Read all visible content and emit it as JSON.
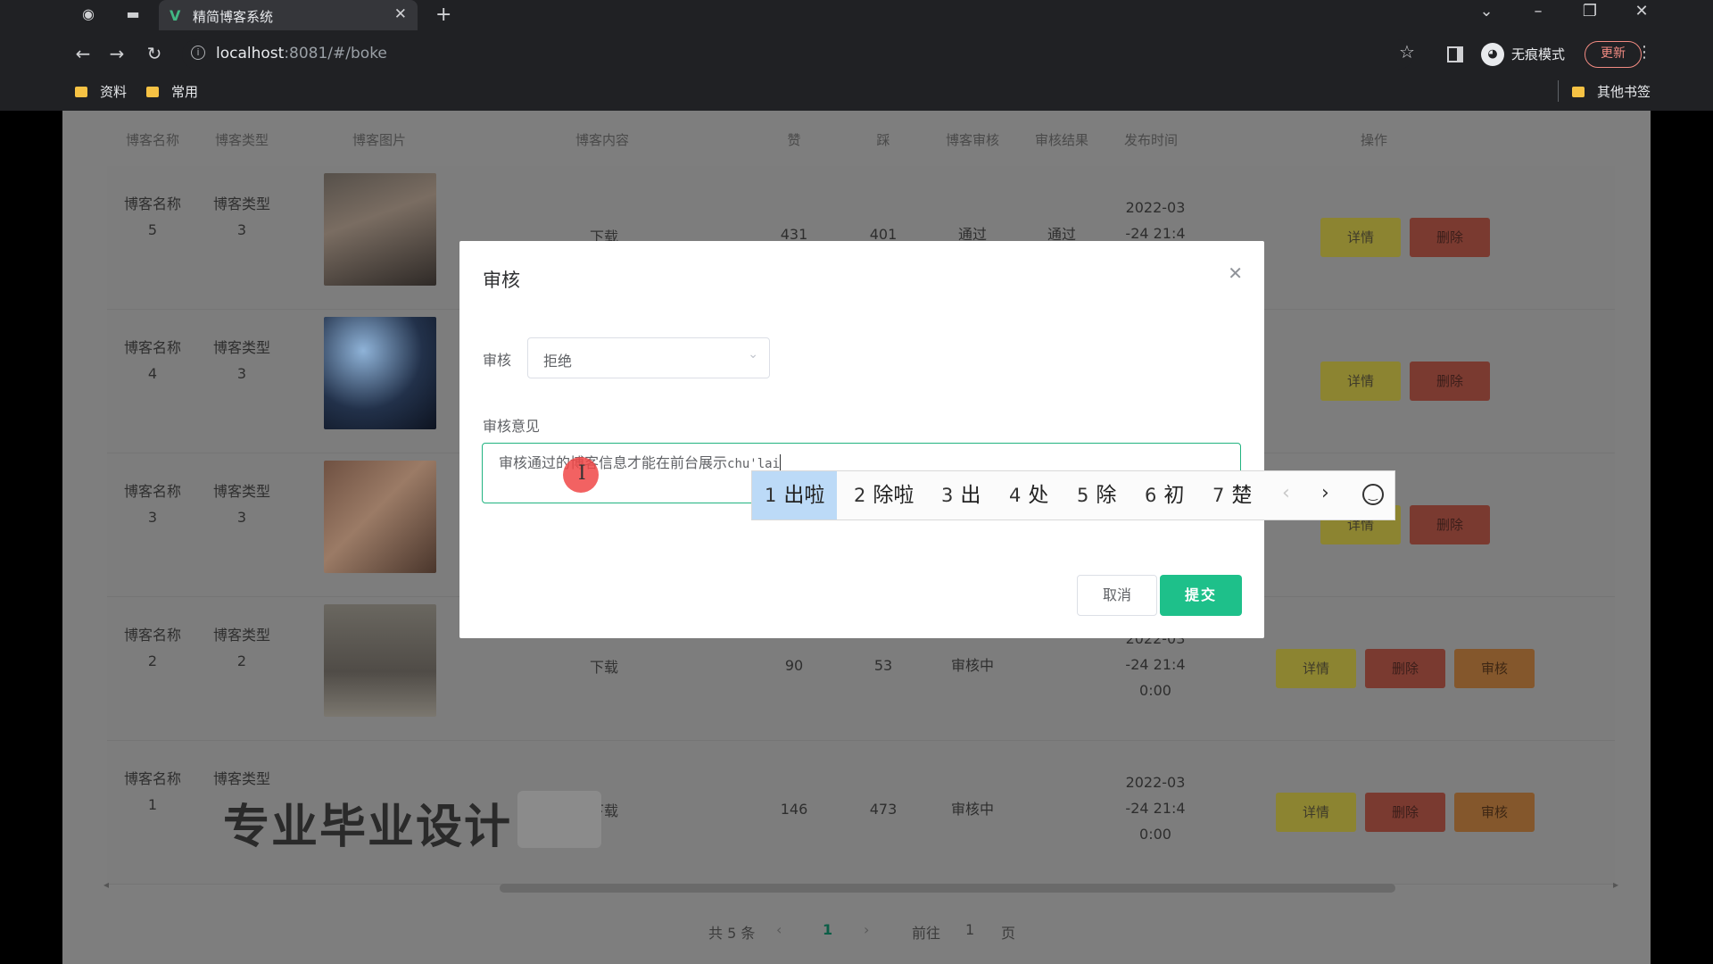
{
  "browser": {
    "tab_title": "精简博客系统",
    "tab_icon": "vue-logo-icon",
    "url_host": "localhost",
    "url_rest": ":8081/#/boke",
    "incognito_label": "无痕模式",
    "update_label": "更新",
    "bookmarks": [
      "资料",
      "常用"
    ],
    "other_bookmarks": "其他书签",
    "accent": "#42b883"
  },
  "table": {
    "headers": [
      "博客名称",
      "博客类型",
      "博客图片",
      "博客内容",
      "赞",
      "踩",
      "博客审核",
      "审核结果",
      "发布时间",
      "操作"
    ],
    "download_label": "下载",
    "detail_label": "详情",
    "delete_label": "删除",
    "audit_label": "审核",
    "rows": [
      {
        "name": "博客名称\n5",
        "type": "博客类型\n3",
        "likes": "431",
        "dislikes": "401",
        "audit": "通过",
        "result": "通过",
        "time": "2022-03\n-24 21:4"
      },
      {
        "name": "博客名称\n4",
        "type": "博客类型\n3",
        "likes": "",
        "dislikes": "",
        "audit": "",
        "result": "",
        "time": ""
      },
      {
        "name": "博客名称\n3",
        "type": "博客类型\n3",
        "likes": "",
        "dislikes": "",
        "audit": "",
        "result": "",
        "time": ""
      },
      {
        "name": "博客名称\n2",
        "type": "博客类型\n2",
        "likes": "90",
        "dislikes": "53",
        "audit": "审核中",
        "result": "",
        "time": "2022-03\n-24 21:4\n0:00"
      },
      {
        "name": "博客名称\n1",
        "type": "博客类型\n",
        "likes": "146",
        "dislikes": "473",
        "audit": "审核中",
        "result": "",
        "time": "2022-03\n-24 21:4\n0:00"
      }
    ]
  },
  "pagination": {
    "total": "共 5 条",
    "current": "1",
    "goto_prefix": "前往",
    "goto_value": "1",
    "goto_suffix": "页"
  },
  "watermark": "专业毕业设计",
  "modal": {
    "title": "审核",
    "audit_label": "审核",
    "audit_value": "拒绝",
    "opinion_label": "审核意见",
    "opinion_text": "审核通过的博客信息才能在前台展示",
    "composition": "chu'lai",
    "cancel_label": "取消",
    "submit_label": "提交",
    "submit_color": "#1ec08a"
  },
  "ime": {
    "candidates": [
      {
        "num": "1",
        "text": "出啦"
      },
      {
        "num": "2",
        "text": "除啦"
      },
      {
        "num": "3",
        "text": "出"
      },
      {
        "num": "4",
        "text": "处"
      },
      {
        "num": "5",
        "text": "除"
      },
      {
        "num": "6",
        "text": "初"
      },
      {
        "num": "7",
        "text": "楚"
      }
    ]
  }
}
